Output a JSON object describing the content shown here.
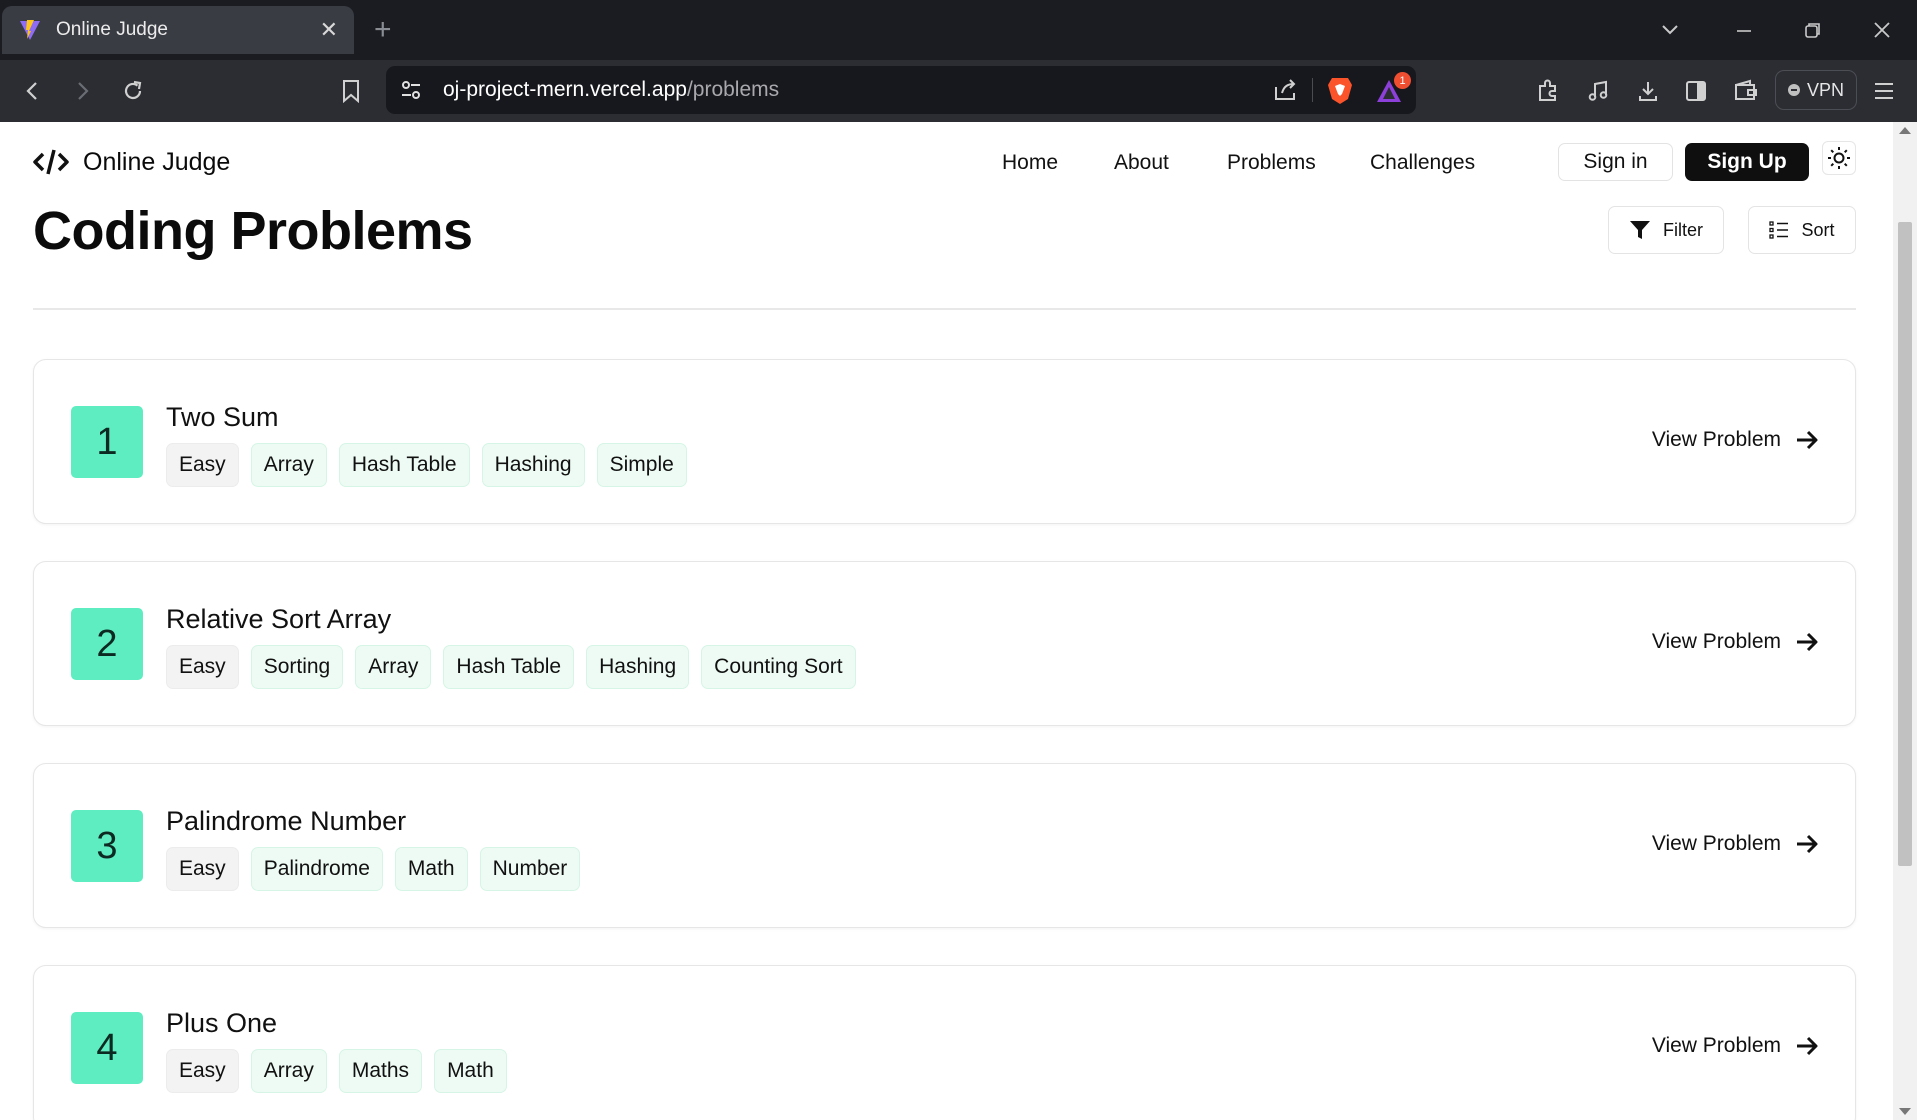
{
  "browser": {
    "tab_title": "Online Judge",
    "url_host": "oj-project-mern.vercel.app",
    "url_path": "/problems",
    "vpn_label": "VPN",
    "notification_count": "1"
  },
  "nav": {
    "logo_text": "Online Judge",
    "links": [
      "Home",
      "About",
      "Problems",
      "Challenges"
    ],
    "signin_label": "Sign in",
    "signup_label": "Sign Up"
  },
  "page": {
    "title": "Coding Problems",
    "filter_label": "Filter",
    "sort_label": "Sort"
  },
  "colors": {
    "accent": "#5eecc1",
    "tag_bg": "#eefbf4",
    "difficulty_bg": "#f3f3f3"
  },
  "problems": [
    {
      "number": "1",
      "title": "Two Sum",
      "difficulty": "Easy",
      "tags": [
        "Array",
        "Hash Table",
        "Hashing",
        "Simple"
      ],
      "link_label": "View Problem"
    },
    {
      "number": "2",
      "title": "Relative Sort Array",
      "difficulty": "Easy",
      "tags": [
        "Sorting",
        "Array",
        "Hash Table",
        "Hashing",
        "Counting Sort"
      ],
      "link_label": "View Problem"
    },
    {
      "number": "3",
      "title": "Palindrome Number",
      "difficulty": "Easy",
      "tags": [
        "Palindrome",
        "Math",
        "Number"
      ],
      "link_label": "View Problem"
    },
    {
      "number": "4",
      "title": "Plus One",
      "difficulty": "Easy",
      "tags": [
        "Array",
        "Maths",
        "Math"
      ],
      "link_label": "View Problem"
    }
  ]
}
